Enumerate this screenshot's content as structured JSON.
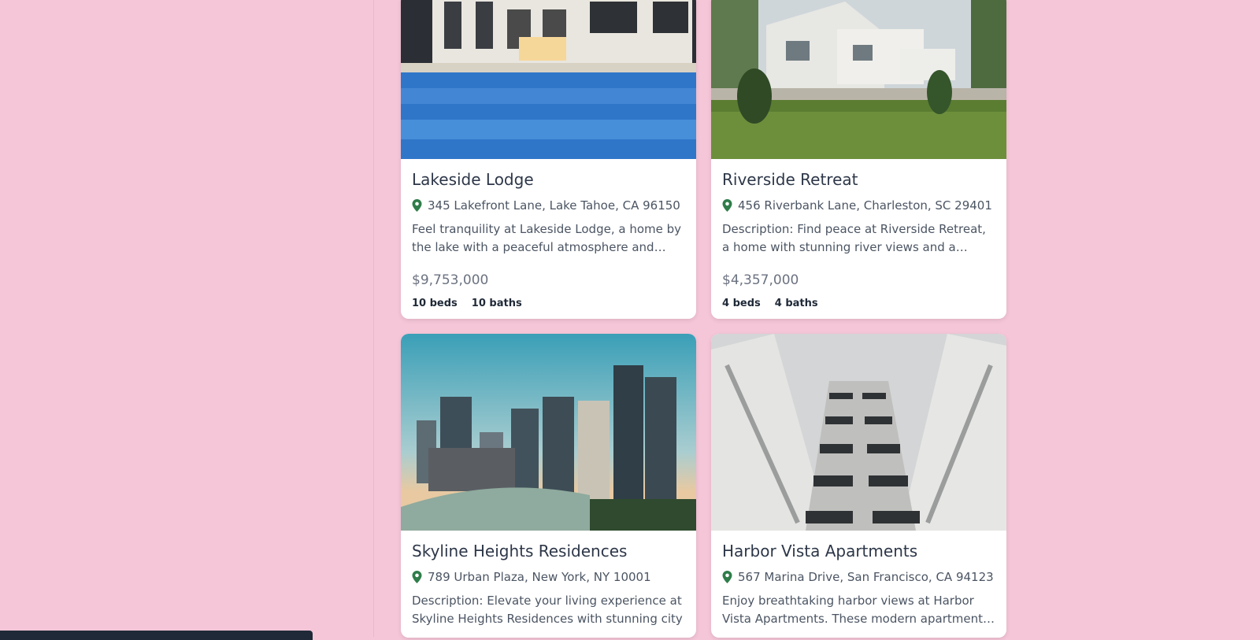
{
  "listings": [
    {
      "title": "Lakeside Lodge",
      "address": "345 Lakefront Lane, Lake Tahoe, CA 96150",
      "description": "Feel tranquility at Lakeside Lodge, a home by the lake with a peaceful atmosphere and comfortab...",
      "price": "$9,753,000",
      "beds": "10 beds",
      "baths": "10 baths",
      "image": "villa-with-pool-photo"
    },
    {
      "title": "Riverside Retreat",
      "address": "456 Riverbank Lane, Charleston, SC 29401",
      "description": "Description: Find peace at Riverside Retreat, a home with stunning river views and a beautiful...",
      "price": "$4,357,000",
      "beds": "4 beds",
      "baths": "4 baths",
      "image": "house-with-lawn-photo"
    },
    {
      "title": "Skyline Heights Residences",
      "address": "789 Urban Plaza, New York, NY 10001",
      "description": "Description: Elevate your living experience at Skyline Heights Residences with stunning city",
      "image": "city-highrise-photo"
    },
    {
      "title": "Harbor Vista Apartments",
      "address": "567 Marina Drive, San Francisco, CA 94123",
      "description": "Enjoy breathtaking harbor views at Harbor Vista Apartments. These modern apartments offer",
      "image": "tower-lookup-photo"
    }
  ],
  "colors": {
    "background": "#f5c6d8",
    "pin": "#2f7d4a"
  }
}
